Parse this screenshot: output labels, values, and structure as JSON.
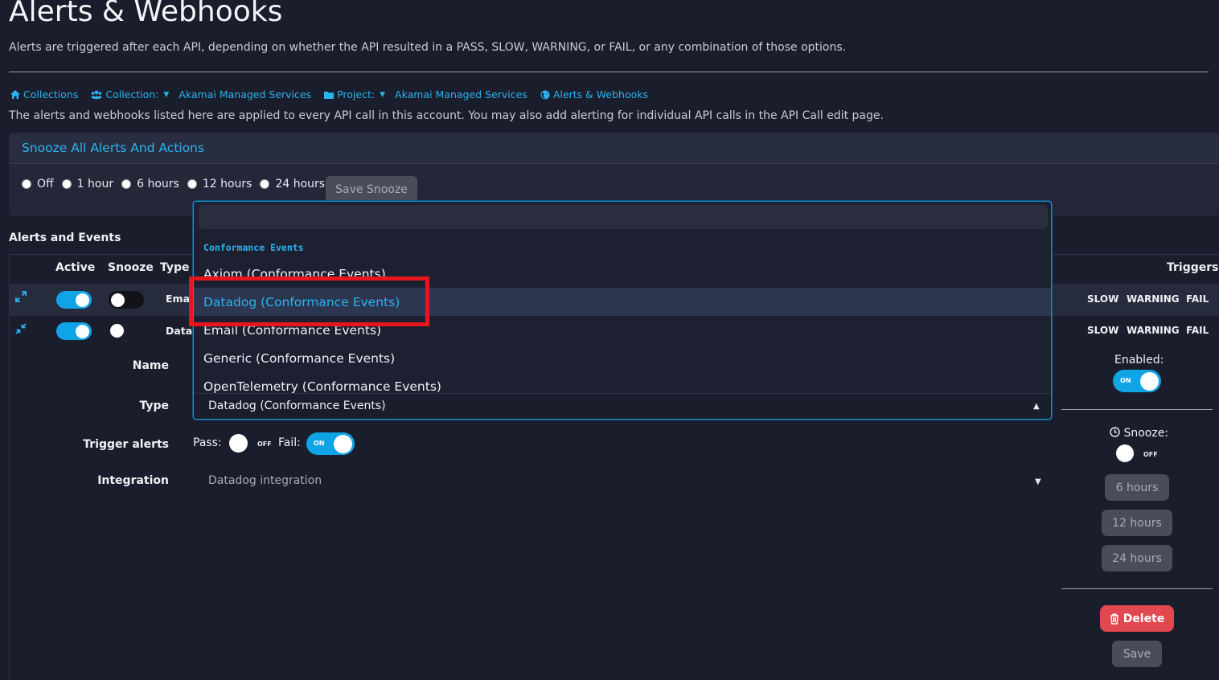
{
  "header": {
    "title": "Alerts & Webhooks",
    "subtitle": "Alerts are triggered after each API, depending on whether the API resulted in a PASS, SLOW, WARNING, or FAIL, or any combination of those options."
  },
  "breadcrumbs": {
    "collections": "Collections",
    "collection_label": "Collection:",
    "collection_value": "Akamai Managed Services",
    "project_label": "Project:",
    "project_value": "Akamai Managed Services",
    "current": "Alerts & Webhooks"
  },
  "account_note": "The alerts and webhooks listed here are applied to every API call in this account. You may also add alerting for individual API calls in the API Call edit page.",
  "snooze_all": {
    "title": "Snooze All Alerts And Actions",
    "options": [
      "Off",
      "1 hour",
      "6 hours",
      "12 hours",
      "24 hours"
    ],
    "save_label": "Save Snooze"
  },
  "alerts_table": {
    "section_label": "Alerts and Events",
    "columns": {
      "active": "Active",
      "snooze": "Snooze",
      "type": "Type",
      "triggers": "Triggers"
    },
    "rows": [
      {
        "active": true,
        "snoozed": false,
        "type": "Emai",
        "triggers": [
          "SLOW",
          "WARNING",
          "FAIL"
        ]
      },
      {
        "active": true,
        "snoozed": false,
        "type": "Datac",
        "triggers": [
          "SLOW",
          "WARNING",
          "FAIL"
        ]
      }
    ]
  },
  "edit_form": {
    "name_label": "Name",
    "type_label": "Type",
    "trigger_label": "Trigger alerts",
    "pass_label": "Pass:",
    "pass_state": "OFF",
    "fail_label": "Fail:",
    "fail_state": "ON",
    "integration_label": "Integration",
    "integration_value": "Datadog integration"
  },
  "type_dropdown": {
    "search_value": "",
    "group": "Conformance Events",
    "options": [
      "Axiom (Conformance Events)",
      "Datadog (Conformance Events)",
      "Email (Conformance Events)",
      "Generic (Conformance Events)",
      "OpenTelemetry (Conformance Events)"
    ],
    "highlighted": "Datadog (Conformance Events)",
    "selected_value": "Datadog (Conformance Events)"
  },
  "right_panel": {
    "enabled_label": "Enabled:",
    "enabled_state": "ON",
    "snooze_label": "Snooze:",
    "snooze_state": "OFF",
    "snooze_options": [
      "6 hours",
      "12 hours",
      "24 hours"
    ],
    "delete_label": "Delete",
    "save_label": "Save"
  },
  "colors": {
    "background": "#1a1d2b",
    "accent": "#2bb3ee",
    "toggle_on": "#0fa4e6",
    "danger": "#e2484f",
    "annotation_box": "#e8151f"
  },
  "icons": [
    "home-icon",
    "users-icon",
    "folder-icon",
    "globe-icon",
    "expand-icon",
    "collapse-icon",
    "clock-icon",
    "trash-icon",
    "caret-down-icon",
    "caret-up-icon"
  ]
}
